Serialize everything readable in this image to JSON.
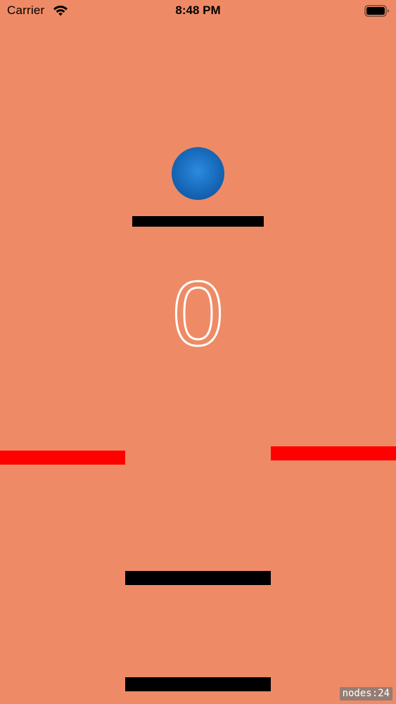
{
  "status_bar": {
    "carrier": "Carrier",
    "time": "8:48 PM",
    "wifi_icon": "wifi-icon",
    "battery_icon": "battery-full-icon"
  },
  "game": {
    "score": "0",
    "ball_color": "#1a6ec0",
    "background_color": "#ee8b66",
    "platform_color": "#000000",
    "wall_color": "#ff0000"
  },
  "debug": {
    "node_count_label": "nodes:24"
  }
}
